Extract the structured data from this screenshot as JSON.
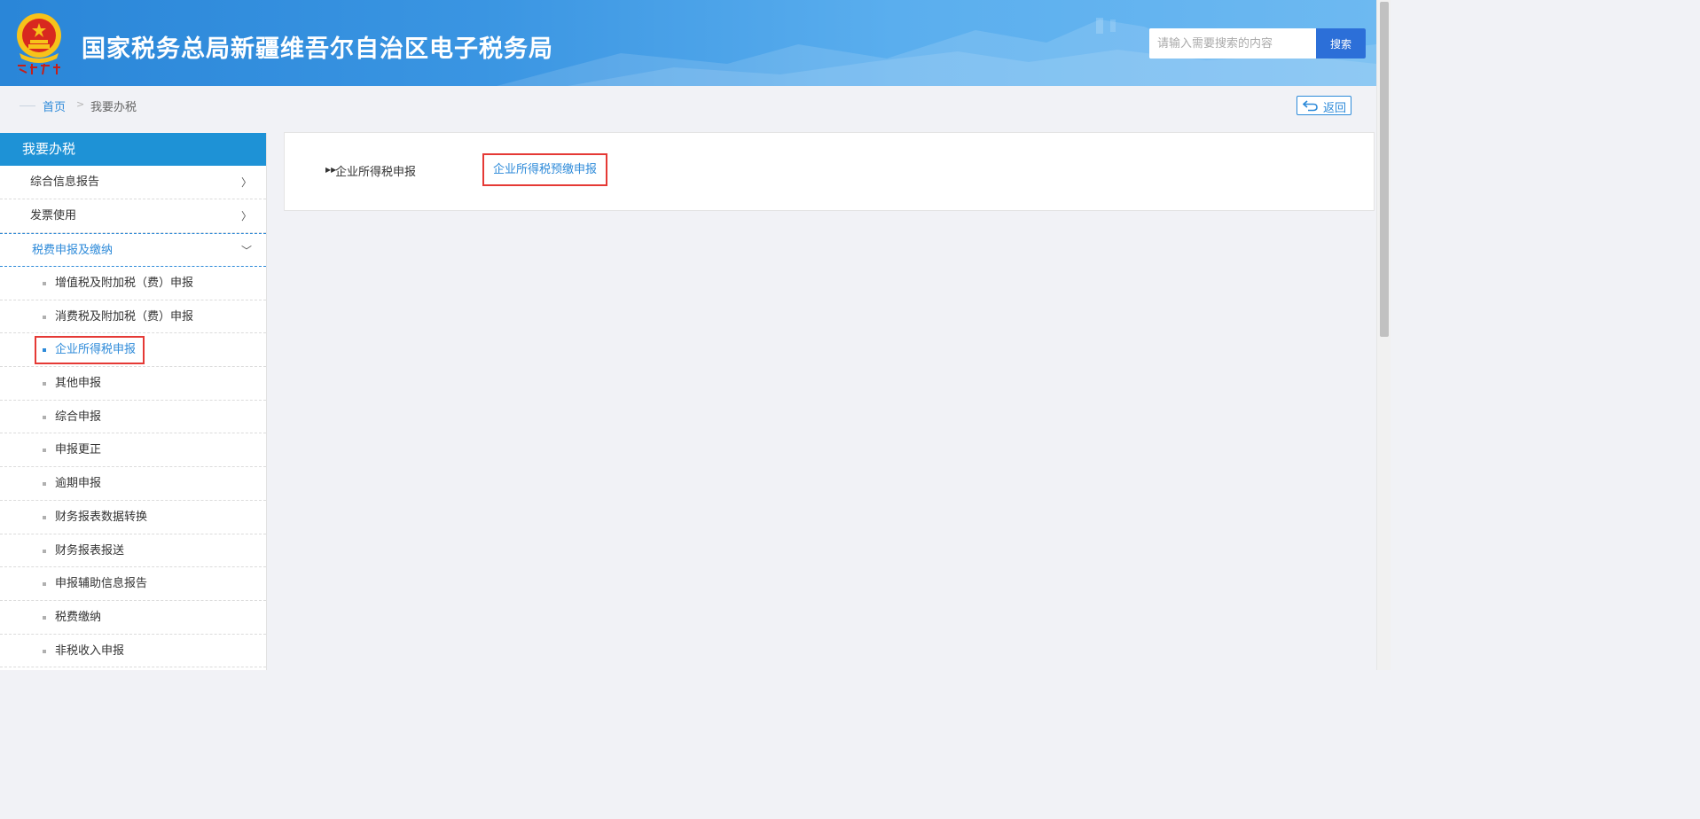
{
  "header": {
    "title": "国家税务总局新疆维吾尔自治区电子税务局",
    "emblem_caption": "中国税务",
    "search_placeholder": "请输入需要搜索的内容",
    "search_button": "搜索"
  },
  "breadcrumb": {
    "home": "首页",
    "separator": ">",
    "current": "我要办税",
    "back_button": "返回"
  },
  "sidebar": {
    "title": "我要办税",
    "items": [
      {
        "label": "综合信息报告",
        "chevron": "〉"
      },
      {
        "label": "发票使用",
        "chevron": "〉"
      },
      {
        "label": "税费申报及缴纳",
        "chevron": "﹀"
      }
    ],
    "sub_items": [
      {
        "label": "增值税及附加税（费）申报"
      },
      {
        "label": "消费税及附加税（费）申报"
      },
      {
        "label": "企业所得税申报"
      },
      {
        "label": "其他申报"
      },
      {
        "label": "综合申报"
      },
      {
        "label": "申报更正"
      },
      {
        "label": "逾期申报"
      },
      {
        "label": "财务报表数据转换"
      },
      {
        "label": "财务报表报送"
      },
      {
        "label": "申报辅助信息报告"
      },
      {
        "label": "税费缴纳"
      },
      {
        "label": "非税收入申报"
      }
    ]
  },
  "main": {
    "category": "企业所得税申报",
    "links": [
      "企业所得税预缴申报"
    ]
  },
  "colors": {
    "header_blue": "#2a86d8",
    "sidebar_title_bg": "#1e92d6",
    "link_blue": "#2d8ad9",
    "highlight_red": "#e53935",
    "search_button_bg": "#2c6fd8"
  }
}
